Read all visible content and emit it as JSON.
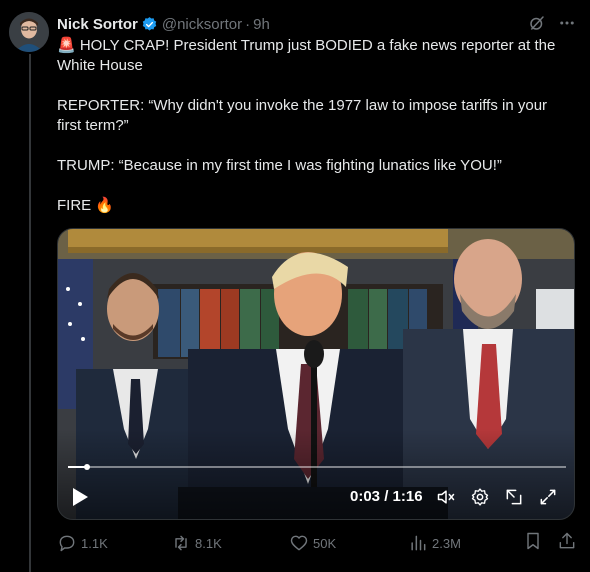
{
  "author": {
    "name": "Nick Sortor",
    "handle": "@nicksortor",
    "time": "9h",
    "verified": true
  },
  "tweet": {
    "paragraphs": [
      "🚨 HOLY CRAP! President Trump just BODIED a fake news reporter at the White House",
      "REPORTER: “Why didn't you invoke the 1977 law to impose tariffs in your first term?”",
      "TRUMP: “Because in my first time I was fighting lunatics like YOU!”",
      "FIRE 🔥"
    ]
  },
  "video": {
    "time_display": "0:03 / 1:16",
    "progress": 0.039,
    "icons": [
      "play-icon",
      "mute-icon",
      "settings-icon",
      "picture-in-picture-icon",
      "fullscreen-icon"
    ]
  },
  "metrics": {
    "replies": "1.1K",
    "reposts": "8.1K",
    "likes": "50K",
    "views": "2.3M"
  },
  "colors": {
    "background": "#000000",
    "text": "#e7e9ea",
    "muted": "#71767b",
    "verified": "#1d9bf0"
  }
}
